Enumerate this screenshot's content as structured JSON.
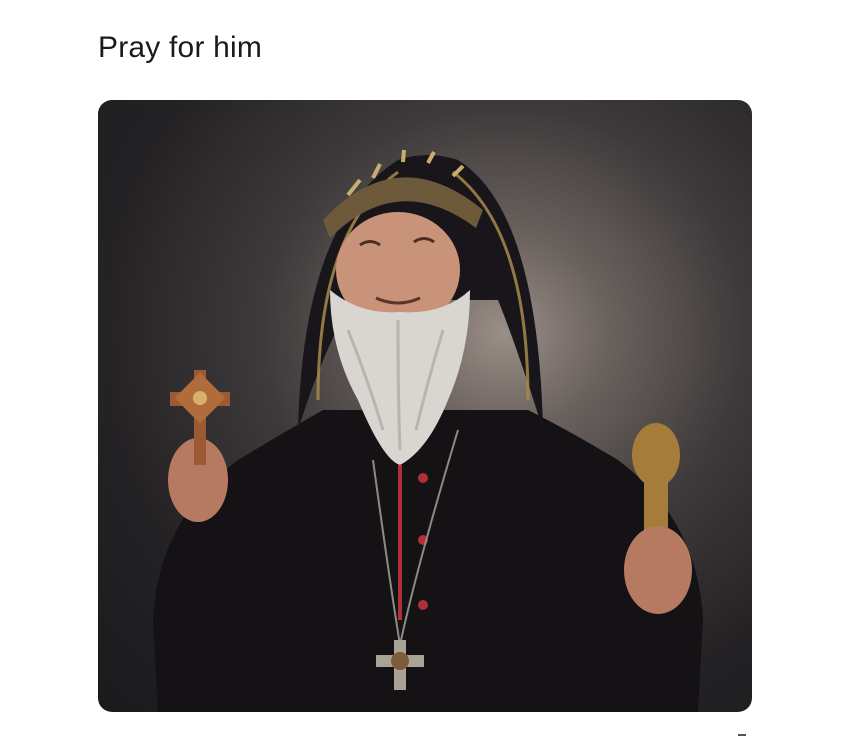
{
  "post": {
    "text": "Pray for him"
  },
  "photo": {
    "subject": "bearded-cleric-portrait",
    "colors": {
      "background": "#2a2729",
      "robe": "#141215",
      "hood_trim": "#a8894a",
      "beard": "#d9d6d2",
      "skin": "#c9937a",
      "red_piping": "#b0303a",
      "gold": "#a67c3a"
    }
  }
}
